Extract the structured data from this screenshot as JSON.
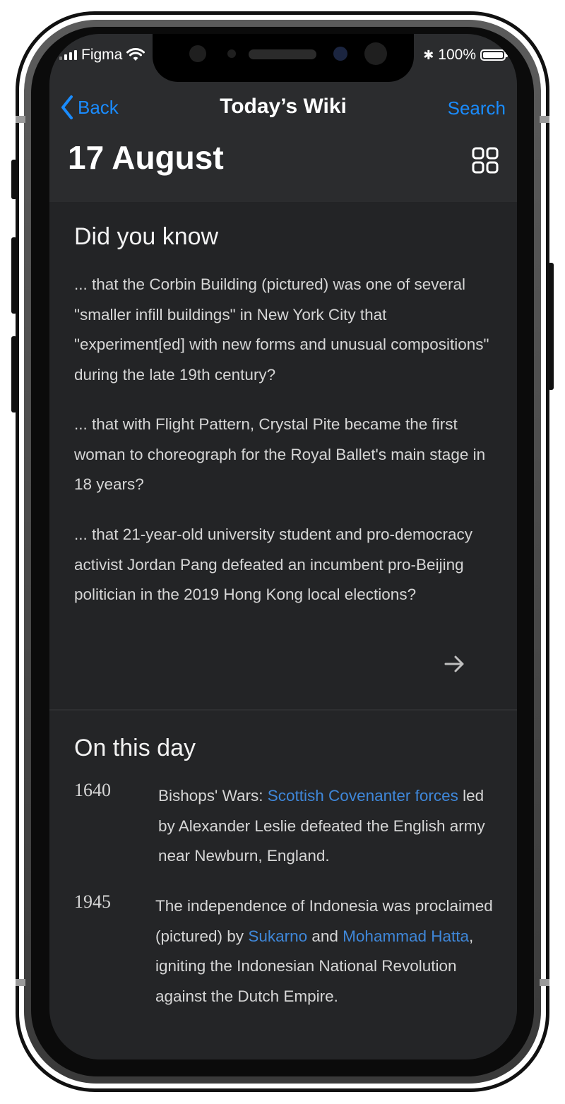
{
  "status_bar": {
    "carrier": "Figma",
    "battery_text": "100%"
  },
  "nav": {
    "back_label": "Back",
    "title": "Today’s Wiki",
    "search_label": "Search"
  },
  "page": {
    "date_heading": "17 August"
  },
  "did_you_know": {
    "heading": "Did you know",
    "items": [
      "... that the Corbin Building (pictured) was one of several \"smaller infill buildings\" in New York City that \"experiment[ed] with new forms and unusual compositions\" during the late 19th century?",
      "... that with Flight Pattern, Crystal Pite became the first woman to choreograph for the Royal Ballet's main stage in 18 years?",
      "... that 21-year-old university student and pro-democracy activist Jordan Pang defeated an incumbent pro-Beijing politician in the 2019 Hong Kong local elections?"
    ]
  },
  "on_this_day": {
    "heading": "On this day",
    "events": [
      {
        "year": "1640",
        "text_before": "Bishops' Wars: ",
        "link1": "Scottish Covenanter forces",
        "text_after": " led by Alexander Leslie defeated the English army near Newburn, England."
      },
      {
        "year": "1945",
        "text_before": "The independence of Indonesia was proclaimed (pictured) by ",
        "link1": "Sukarno",
        "text_middle": " and ",
        "link2": "Mohammad Hatta",
        "text_after": ", igniting the Indonesian National Revolution against the Dutch Empire."
      }
    ]
  },
  "colors": {
    "accent": "#1a8cff",
    "link": "#3f87d9",
    "background": "#252628"
  }
}
